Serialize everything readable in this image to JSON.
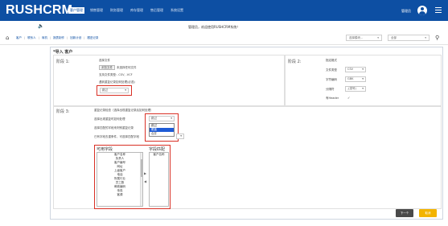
{
  "app": {
    "logo": "RUSHCRM",
    "nav": [
      "客户管理",
      "销售管理",
      "财务管理",
      "库存管理",
      "售后管理",
      "系统设置"
    ],
    "user_name": "管理员",
    "notice": "管理员，欢迎使用RUSHCRM系统！"
  },
  "breadcrumb": {
    "items": [
      "客户",
      "联系人",
      "商机",
      "报表制作",
      "回款计划",
      "跟进记录"
    ],
    "module_select": "选择模块...",
    "scope_select": "全部"
  },
  "panel": {
    "title": "*导入 客户",
    "stage1": {
      "label": "阶段 1:",
      "choose_file_label": "选择文件",
      "browse_button": "浏览文件",
      "no_file_text": "未选择任何文件",
      "supported_types": "支持文件类型: .CSV, .VCF",
      "duplicate_label": "遇到重复记录如何处理(必选)",
      "duplicate_value": "跳过"
    },
    "stage2": {
      "label": "阶段 2:",
      "section_title": "指定格式",
      "file_type_label": "文件类型",
      "file_type_value": "CSV",
      "encoding_label": "字符编码",
      "encoding_value": "GBK",
      "delimiter_label": "分隔符",
      "delimiter_value": ",(逗号)",
      "has_header_label": "有Header"
    },
    "stage3": {
      "label": "阶段 3:",
      "section_title": "重复记录检查（选择出现重复记录后如何处理）",
      "handle_label": "选择出现重复时如何处理",
      "handle_value": "跳过",
      "handle_options": [
        "跳过",
        "覆盖",
        "合并"
      ],
      "match_label": "选择匹配的字段来判别重复记录",
      "skip_label": "已有字段去重条件，可选择匹配字段",
      "available_header": "可用字段",
      "matched_header": "字段匹配",
      "available_fields": [
        "客户名称",
        "负责人",
        "客户编号",
        "网址",
        "上级客户",
        "电话",
        "所属行业",
        "员工数",
        "邮政编码",
        "传真",
        "客源"
      ],
      "matched_fields": [
        "客户名称"
      ]
    },
    "next_button": "下一个",
    "cancel_button": "取消"
  },
  "colors": {
    "nav_bg": "#0d4fa3",
    "highlight": "#d93025",
    "cancel_btn": "#f3b400"
  }
}
